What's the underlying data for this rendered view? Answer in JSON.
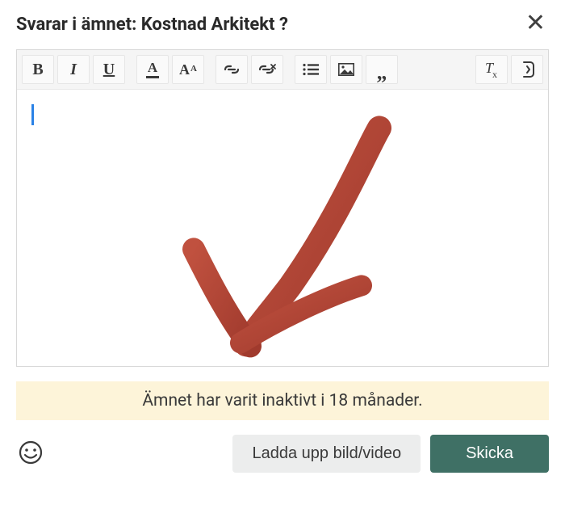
{
  "header": {
    "title": "Svarar i ämnet: Kostnad Arkitekt ?"
  },
  "toolbar": {
    "bold": "B",
    "italic": "I",
    "underline": "U",
    "textcolor": "A",
    "fontsize_big": "A",
    "fontsize_small": "A"
  },
  "notice": {
    "text": "Ämnet har varit inaktivt i 18 månader."
  },
  "footer": {
    "upload_label": "Ladda upp bild/video",
    "send_label": "Skicka"
  }
}
